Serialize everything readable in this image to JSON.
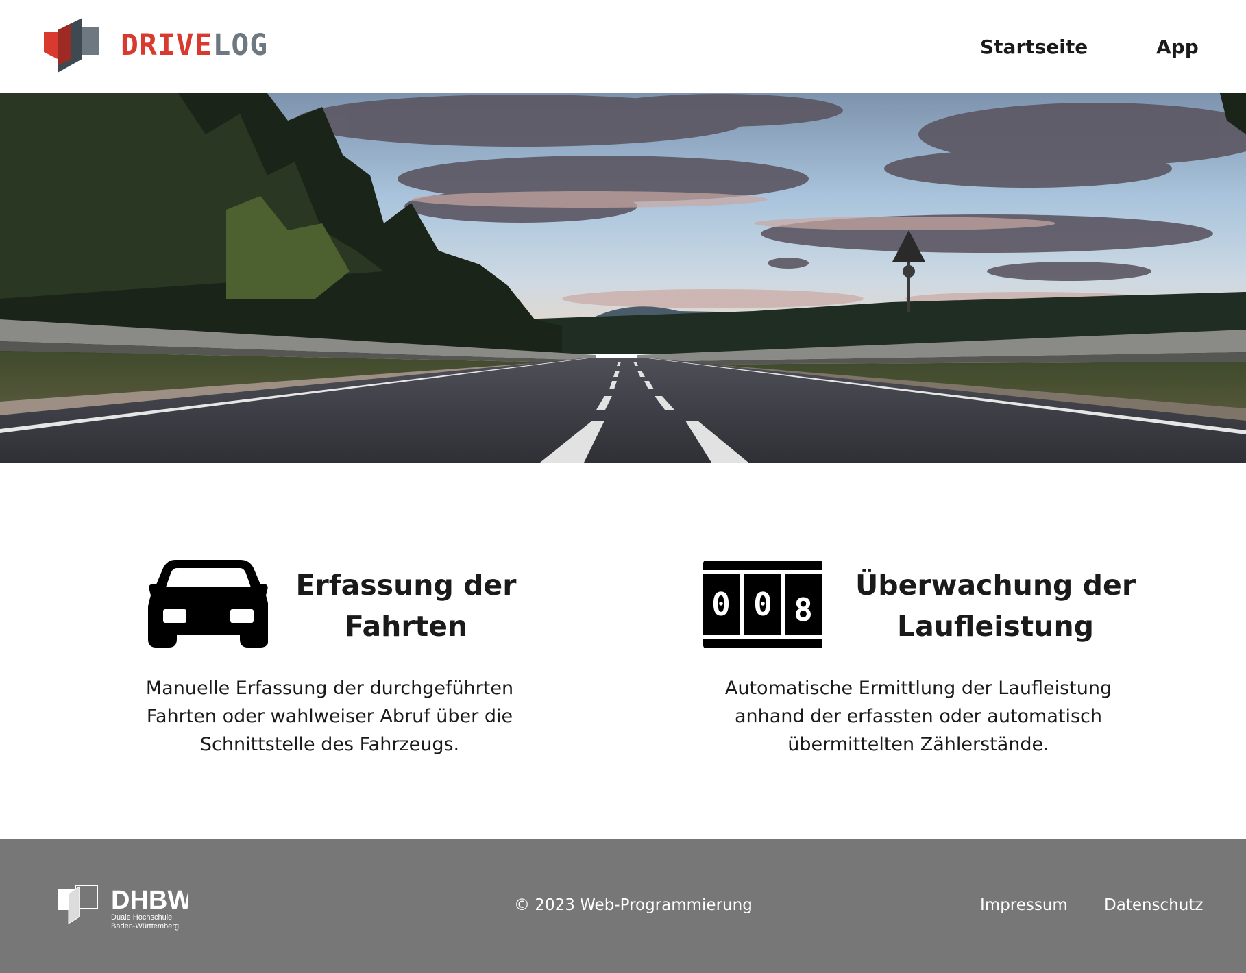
{
  "brand": {
    "part1": "DRIVE",
    "part2": "LOG",
    "color_primary": "#d93a2f",
    "color_secondary": "#6d7880"
  },
  "nav": {
    "items": [
      "Startseite",
      "App"
    ]
  },
  "hero": {
    "image": "road-landscape-photo"
  },
  "features": [
    {
      "icon": "car-icon",
      "title": "Erfassung der\nFahrten",
      "text": "Manuelle Erfassung der durchgeführten Fahrten oder wahlweiser Abruf über die Schnittstelle des Fahrzeugs."
    },
    {
      "icon": "odometer-icon",
      "digits": [
        "0",
        "0",
        "8"
      ],
      "title": "Überwachung der\nLaufleistung",
      "text": "Automatische Ermittlung der Laufleistung anhand der erfassten oder automatisch übermittelten Zählerstände."
    }
  ],
  "footer": {
    "logo": {
      "name": "DHBW",
      "subtitle_line1": "Duale Hochschule",
      "subtitle_line2": "Baden-Württemberg"
    },
    "copyright": "© 2023 Web-Programmierung",
    "links": [
      "Impressum",
      "Datenschutz"
    ],
    "background": "#777777"
  }
}
